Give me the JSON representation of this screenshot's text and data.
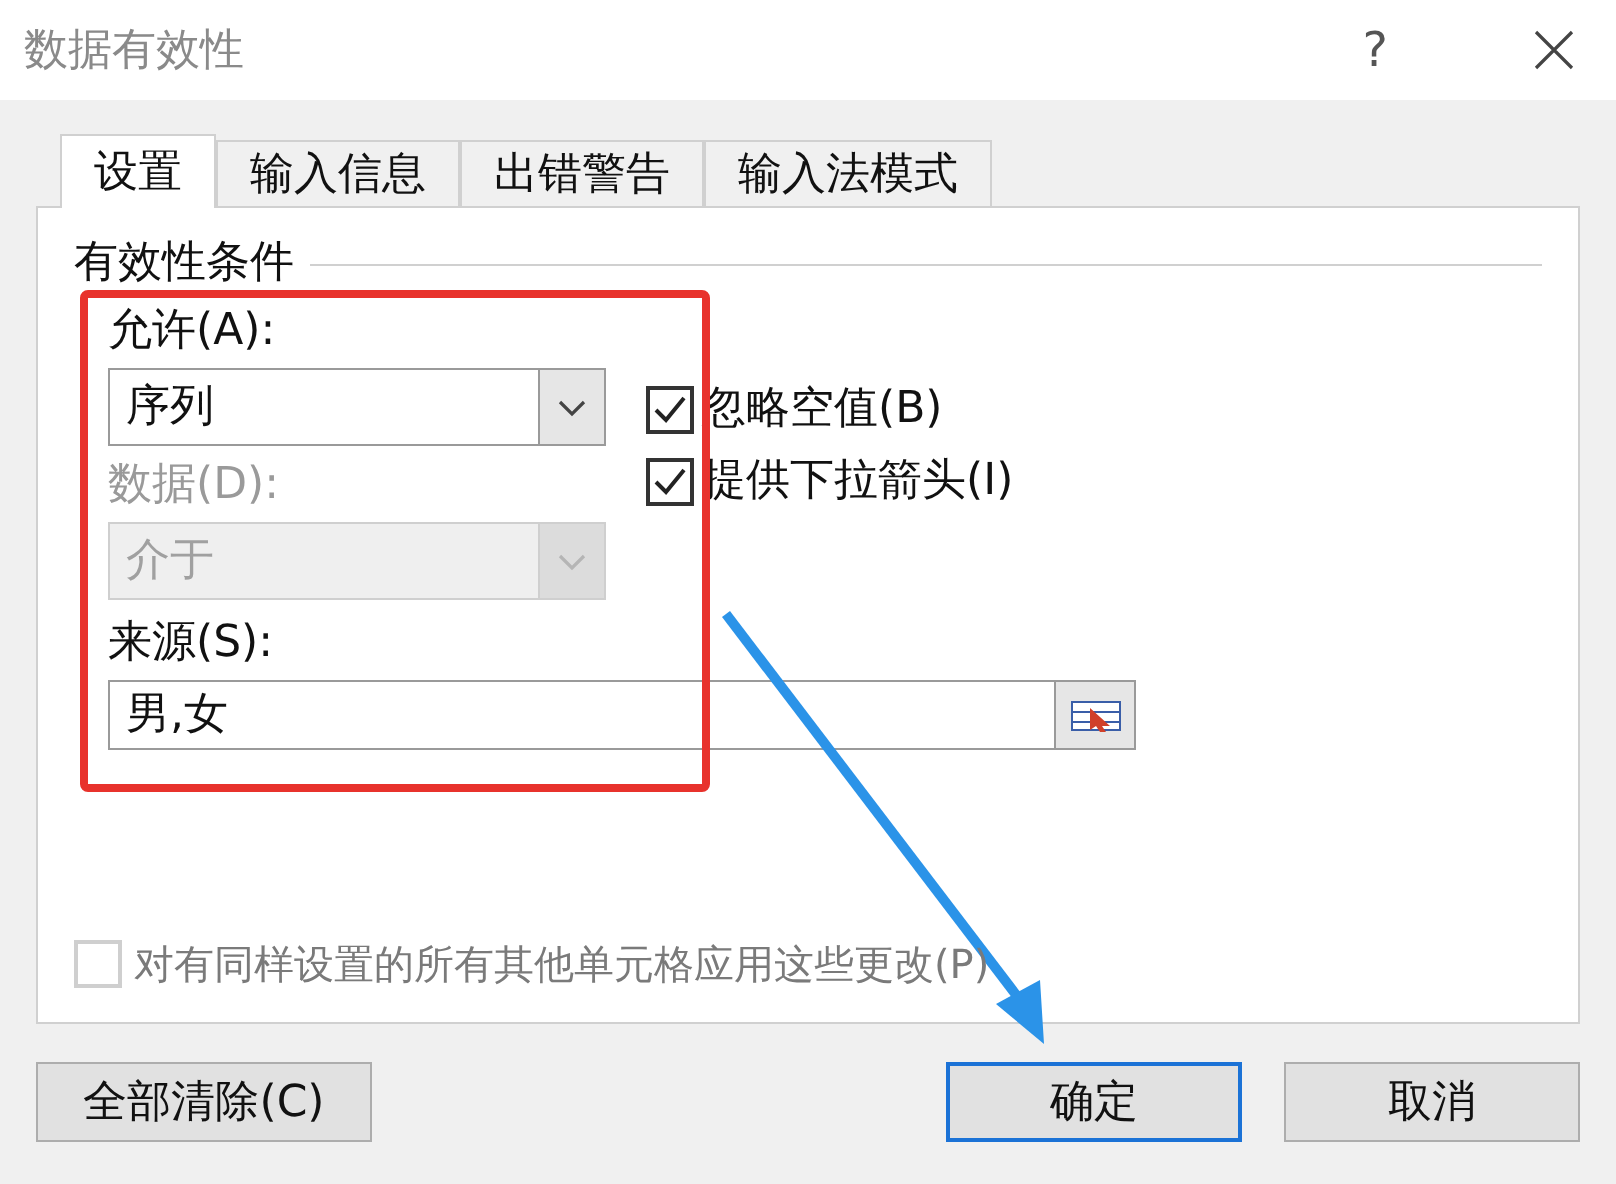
{
  "window": {
    "title": "数据有效性",
    "help": "?"
  },
  "tabs": [
    {
      "label": "设置",
      "selected": true
    },
    {
      "label": "输入信息",
      "selected": false
    },
    {
      "label": "出错警告",
      "selected": false
    },
    {
      "label": "输入法模式",
      "selected": false
    }
  ],
  "group_title": "有效性条件",
  "selects": [
    {
      "label": "允许(A):",
      "value": "序列",
      "disabled": false
    },
    {
      "label": "数据(D):",
      "value": "介于",
      "disabled": true
    }
  ],
  "options": [
    {
      "label": "忽略空值(B)",
      "checked": true
    },
    {
      "label": "提供下拉箭头(I)",
      "checked": true
    }
  ],
  "source": {
    "label": "来源(S):",
    "value": "男,女"
  },
  "apply_all": {
    "label": "对有同样设置的所有其他单元格应用这些更改(P)",
    "checked": false,
    "disabled": true
  },
  "buttons": [
    {
      "label": "全部清除(C)",
      "default": false
    },
    {
      "label": "确定",
      "default": true
    },
    {
      "label": "取消",
      "default": false
    }
  ]
}
